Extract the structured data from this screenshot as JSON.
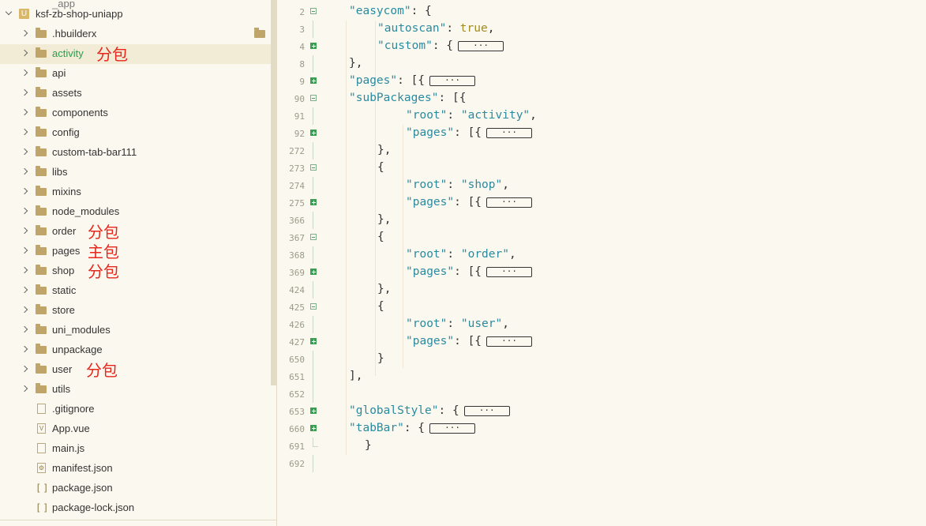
{
  "explorer": {
    "project": "ksf-zb-shop-uniapp",
    "top_partial": "_app",
    "items": [
      {
        "name": ".hbuilderx",
        "type": "folder"
      },
      {
        "name": "activity",
        "type": "folder",
        "selected": true
      },
      {
        "name": "api",
        "type": "folder"
      },
      {
        "name": "assets",
        "type": "folder"
      },
      {
        "name": "components",
        "type": "folder"
      },
      {
        "name": "config",
        "type": "folder"
      },
      {
        "name": "custom-tab-bar111",
        "type": "folder"
      },
      {
        "name": "libs",
        "type": "folder"
      },
      {
        "name": "mixins",
        "type": "folder"
      },
      {
        "name": "node_modules",
        "type": "folder"
      },
      {
        "name": "order",
        "type": "folder"
      },
      {
        "name": "pages",
        "type": "folder"
      },
      {
        "name": "shop",
        "type": "folder"
      },
      {
        "name": "static",
        "type": "folder"
      },
      {
        "name": "store",
        "type": "folder"
      },
      {
        "name": "uni_modules",
        "type": "folder"
      },
      {
        "name": "unpackage",
        "type": "folder"
      },
      {
        "name": "user",
        "type": "folder"
      },
      {
        "name": "utils",
        "type": "folder"
      },
      {
        "name": ".gitignore",
        "type": "file"
      },
      {
        "name": "App.vue",
        "type": "vue"
      },
      {
        "name": "main.js",
        "type": "file"
      },
      {
        "name": "manifest.json",
        "type": "manifest"
      },
      {
        "name": "package.json",
        "type": "json"
      },
      {
        "name": "package-lock.json",
        "type": "json"
      }
    ],
    "annotations": {
      "activity": "分包",
      "order": "分包",
      "pages": "主包",
      "shop": "分包",
      "user": "分包"
    }
  },
  "editor": {
    "ellipsis": "···",
    "lines": [
      {
        "n": "2",
        "fold": "open"
      },
      {
        "n": "3"
      },
      {
        "n": "4",
        "fold": "closed"
      },
      {
        "n": "8"
      },
      {
        "n": "9",
        "fold": "closed"
      },
      {
        "n": "90",
        "fold": "open"
      },
      {
        "n": "91"
      },
      {
        "n": "92",
        "fold": "closed"
      },
      {
        "n": "272"
      },
      {
        "n": "273",
        "fold": "open"
      },
      {
        "n": "274"
      },
      {
        "n": "275",
        "fold": "closed"
      },
      {
        "n": "366"
      },
      {
        "n": "367",
        "fold": "open"
      },
      {
        "n": "368"
      },
      {
        "n": "369",
        "fold": "closed"
      },
      {
        "n": "424"
      },
      {
        "n": "425",
        "fold": "open"
      },
      {
        "n": "426"
      },
      {
        "n": "427",
        "fold": "closed"
      },
      {
        "n": "650"
      },
      {
        "n": "651"
      },
      {
        "n": "652"
      },
      {
        "n": "653",
        "fold": "closed"
      },
      {
        "n": "660",
        "fold": "closed"
      },
      {
        "n": "691"
      },
      {
        "n": "692"
      }
    ],
    "tokens": {
      "l2": "\"easycom\"",
      "l3k": "\"autoscan\"",
      "l3v": "true",
      "l4": "\"custom\"",
      "l9": "\"pages\"",
      "l90": "\"subPackages\"",
      "l91k": "\"root\"",
      "l91v": "\"activity\"",
      "l92": "\"pages\"",
      "l274k": "\"root\"",
      "l274v": "\"shop\"",
      "l275": "\"pages\"",
      "l368k": "\"root\"",
      "l368v": "\"order\"",
      "l369": "\"pages\"",
      "l426k": "\"root\"",
      "l426v": "\"user\"",
      "l427": "\"pages\"",
      "l653": "\"globalStyle\"",
      "l660": "\"tabBar\""
    }
  }
}
